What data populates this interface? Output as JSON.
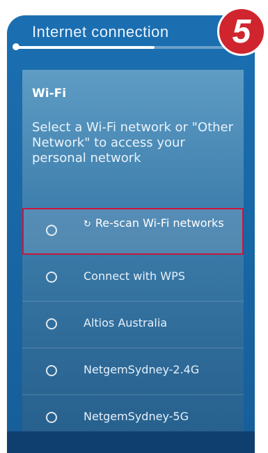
{
  "header": {
    "title": "Internet connection",
    "progress": 0.6
  },
  "step_badge": "5",
  "section": {
    "title": "Wi-Fi",
    "description": "Select a Wi-Fi network or \"Other Network\" to access your personal network"
  },
  "networks": [
    {
      "label": "Re-scan Wi-Fi networks",
      "icon": "refresh-icon",
      "selected": true
    },
    {
      "label": "Connect with WPS"
    },
    {
      "label": "Altios Australia"
    },
    {
      "label": "NetgemSydney-2.4G"
    },
    {
      "label": "NetgemSydney-5G"
    }
  ],
  "colors": {
    "highlight": "#c8173b",
    "badge": "#d0252e",
    "panel": "#3f7fad"
  }
}
